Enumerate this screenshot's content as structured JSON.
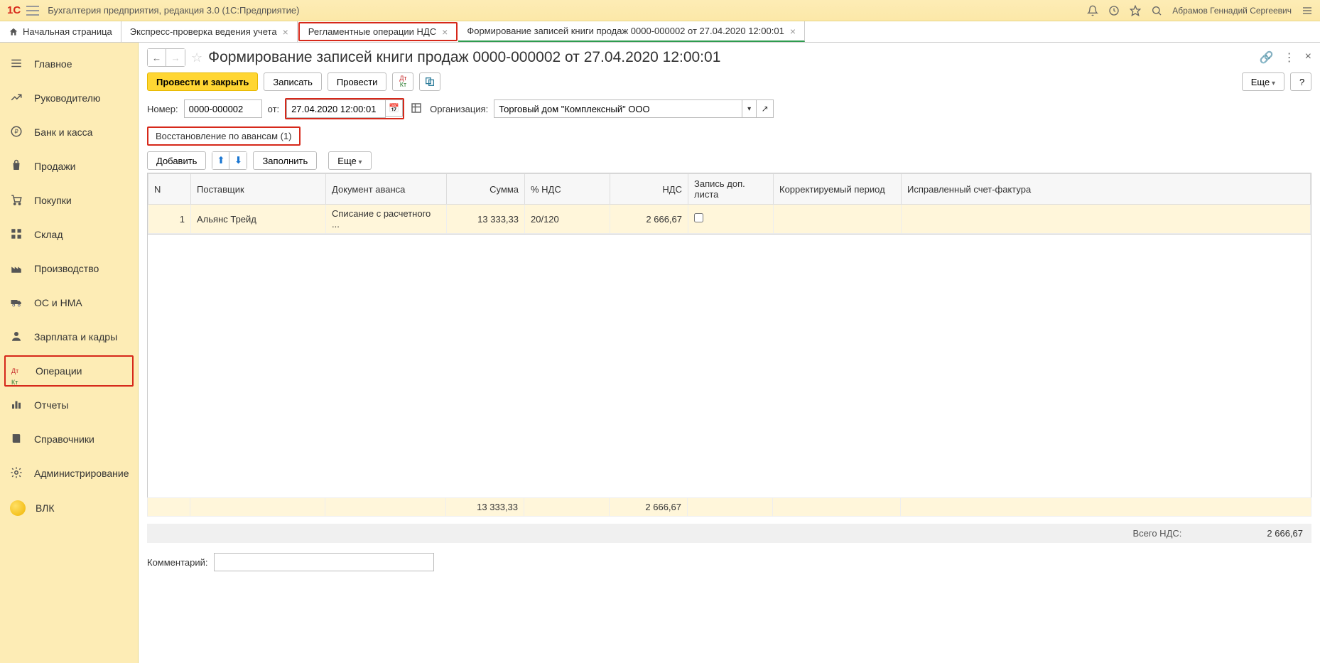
{
  "titlebar": {
    "app_title": "Бухгалтерия предприятия, редакция 3.0   (1С:Предприятие)",
    "user": "Абрамов Геннадий Сергеевич"
  },
  "tabs": {
    "home": "Начальная страница",
    "t1": "Экспресс-проверка ведения учета",
    "t2": "Регламентные операции НДС",
    "t3": "Формирование записей книги продаж 0000-000002 от 27.04.2020 12:00:01"
  },
  "sidebar": {
    "main": "Главное",
    "manager": "Руководителю",
    "bank": "Банк и касса",
    "sales": "Продажи",
    "purchases": "Покупки",
    "warehouse": "Склад",
    "production": "Производство",
    "os": "ОС и НМА",
    "salary": "Зарплата и кадры",
    "operations": "Операции",
    "reports": "Отчеты",
    "catalogs": "Справочники",
    "admin": "Администрирование",
    "vlk": "ВЛК"
  },
  "page": {
    "title": "Формирование записей книги продаж 0000-000002 от 27.04.2020 12:00:01",
    "btn_post_close": "Провести и закрыть",
    "btn_write": "Записать",
    "btn_post": "Провести",
    "btn_more": "Еще",
    "btn_help": "?",
    "lbl_number": "Номер:",
    "val_number": "0000-000002",
    "lbl_from": "от:",
    "val_date": "27.04.2020 12:00:01",
    "lbl_org": "Организация:",
    "val_org": "Торговый дом \"Комплексный\" ООО",
    "innertab": "Восстановление по авансам (1)",
    "btn_add": "Добавить",
    "btn_fill": "Заполнить",
    "btn_more2": "Еще",
    "totals_lbl": "Всего НДС:",
    "totals_val": "2 666,67",
    "comment_lbl": "Комментарий:",
    "comment_val": ""
  },
  "table": {
    "headers": {
      "n": "N",
      "supplier": "Поставщик",
      "doc": "Документ аванса",
      "sum": "Сумма",
      "vat_rate": "% НДС",
      "vat": "НДС",
      "extra": "Запись доп. листа",
      "period": "Корректируемый период",
      "invoice": "Исправленный счет-фактура"
    },
    "row": {
      "n": "1",
      "supplier": "Альянс Трейд",
      "doc": "Списание с расчетного ...",
      "sum": "13 333,33",
      "vat_rate": "20/120",
      "vat": "2 666,67"
    },
    "footer": {
      "sum": "13 333,33",
      "vat": "2 666,67"
    }
  }
}
